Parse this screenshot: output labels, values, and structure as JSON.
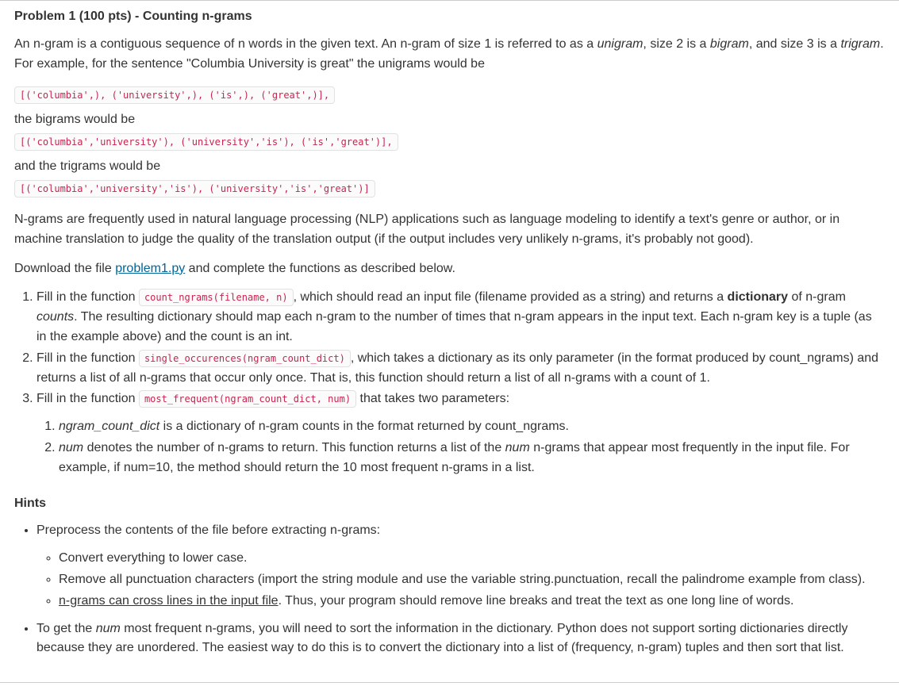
{
  "title": "Problem 1 (100 pts) - Counting n-grams",
  "intro_p1a": "An n-gram is a contiguous sequence of n words in the given text. An n-gram of size 1 is referred to as a ",
  "intro_unigram": "unigram",
  "intro_p1b": ", size 2 is a ",
  "intro_bigram": "bigram",
  "intro_p1c": ", and size 3 is a ",
  "intro_trigram": "trigram",
  "intro_p1d": ". For example, for the sentence \"Columbia University is great\" the unigrams would be",
  "code_unigrams": "[('columbia',), ('university',), ('is',), ('great',)], ",
  "intro_bigrams_label": "the bigrams would be",
  "code_bigrams": "[('columbia','university'), ('university','is'), ('is','great')], ",
  "intro_trigrams_label": "and the trigrams would be",
  "code_trigrams": "[('columbia','university','is'), ('university','is','great')]",
  "nlp_para": "N-grams are frequently used in natural language processing (NLP) applications such as language modeling to identify a text's genre or author, or in machine translation to judge the quality of the translation output (if the output includes very unlikely n-grams, it's probably not good).",
  "download_a": "Download the file ",
  "download_link": "problem1.py",
  "download_b": " and complete the functions as described below.",
  "li1_a": "Fill in the function ",
  "li1_code": "count_ngrams(filename, n)",
  "li1_b": ", which should read an input file (filename provided as a string) and returns a ",
  "li1_dict": "dictionary",
  "li1_c": " of n-gram ",
  "li1_counts": "counts",
  "li1_d": ". The resulting dictionary should map each n-gram to the number of times that n-gram appears in the input text. Each n-gram key is a tuple (as in the example above) and the count is an int.",
  "li2_a": "Fill in the function ",
  "li2_code": "single_occurences(ngram_count_dict)",
  "li2_b": ", which takes a dictionary as its only parameter (in the format produced by count_ngrams) and returns a list of all n-grams that occur only once.  That is, this function should return a list of all n-grams with a count of 1.",
  "li3_a": "Fill in the function ",
  "li3_code": "most_frequent(ngram_count_dict, num)",
  "li3_b": " that takes two parameters:",
  "li3_1a": "ngram_count_dict",
  "li3_1b": " is a dictionary of n-gram counts in the format returned by count_ngrams.",
  "li3_2a": "num",
  "li3_2b": " denotes the number of n-grams to return. This function returns a list of the ",
  "li3_2c": "num",
  "li3_2d": " n-grams that appear most frequently in the input file.  For example, if num=10, the method should return the 10 most frequent n-grams in a list.",
  "hints_heading": "Hints",
  "hint1": "Preprocess the contents of the file before extracting n-grams:",
  "hint1a": "Convert everything to lower case.",
  "hint1b": "Remove all punctuation characters (import the string module and use the variable string.punctuation, recall the palindrome example from class).",
  "hint1c_u": "n-grams can cross lines in the input file",
  "hint1c_rest": ". Thus, your program should remove line breaks and treat the text as one long line of words.",
  "hint2a": "To get the ",
  "hint2_num": "num",
  "hint2b": " most frequent n-grams,  you will need to sort the information in the dictionary. Python does not support sorting dictionaries directly because they are unordered. The easiest way to do this is to convert the dictionary into a list of (frequency, n-gram) tuples and then sort that list."
}
